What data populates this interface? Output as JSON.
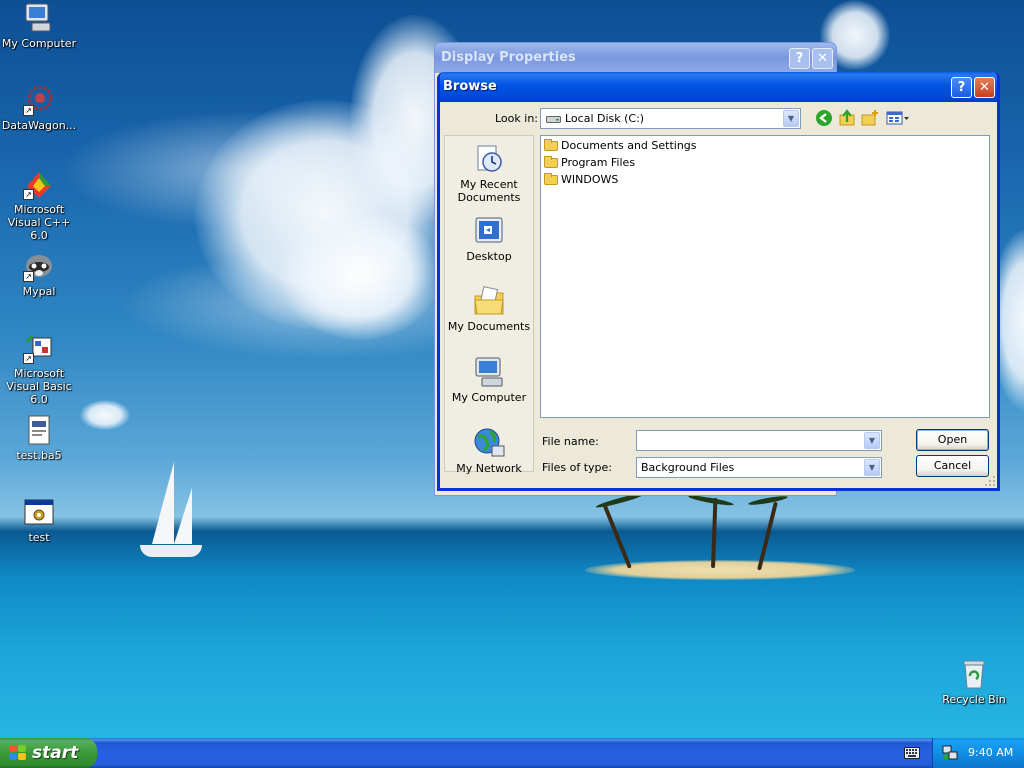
{
  "desktop": {
    "icons": [
      {
        "label": "My Computer",
        "icon": "my-computer-icon"
      },
      {
        "label": "DataWagon...",
        "icon": "datawagon-icon"
      },
      {
        "label": "Microsoft Visual C++ 6.0",
        "icon": "visual-cpp-icon"
      },
      {
        "label": "Mypal",
        "icon": "mypal-icon"
      },
      {
        "label": "Microsoft Visual Basic 6.0",
        "icon": "visual-basic-icon"
      },
      {
        "label": "test.ba5",
        "icon": "document-icon"
      },
      {
        "label": "test",
        "icon": "application-icon"
      }
    ],
    "recycle_bin": {
      "label": "Recycle Bin",
      "icon": "recycle-bin-icon"
    }
  },
  "background_window": {
    "title": "Display Properties",
    "help_label": "?",
    "close_label": "✕"
  },
  "dialog": {
    "title": "Browse",
    "help_label": "?",
    "close_label": "✕",
    "look_in_label": "Look in:",
    "look_in_value": "Local Disk (C:)",
    "toolbar_icons": [
      "back-icon",
      "up-folder-icon",
      "new-folder-icon",
      "view-menu-icon"
    ],
    "places": [
      {
        "label": "My Recent Documents",
        "icon": "recent-documents-icon"
      },
      {
        "label": "Desktop",
        "icon": "desktop-icon"
      },
      {
        "label": "My Documents",
        "icon": "my-documents-icon"
      },
      {
        "label": "My Computer",
        "icon": "my-computer-icon"
      },
      {
        "label": "My Network",
        "icon": "my-network-icon"
      }
    ],
    "files": [
      "Documents and Settings",
      "Program Files",
      "WINDOWS"
    ],
    "file_name_label": "File name:",
    "file_name_value": "",
    "files_of_type_label": "Files of type:",
    "files_of_type_value": "Background Files",
    "open_label": "Open",
    "cancel_label": "Cancel"
  },
  "taskbar": {
    "start_label": "start",
    "clock": "9:40 AM"
  },
  "colors": {
    "title_active": "#0054e3",
    "title_inactive": "#7a96df",
    "start_green": "#3b9a3b",
    "taskbar_blue": "#245edb",
    "dialog_face": "#ece9d8"
  }
}
